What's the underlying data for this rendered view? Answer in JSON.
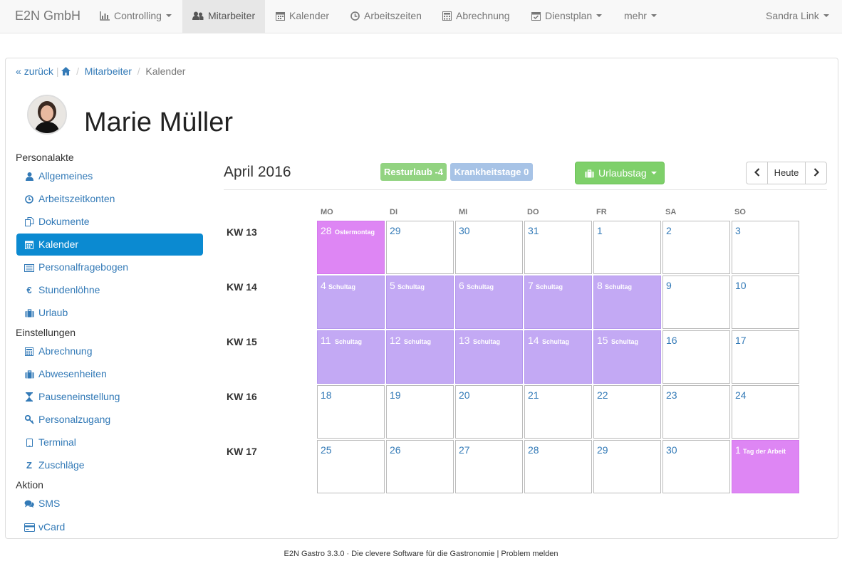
{
  "navbar": {
    "brand": "E2N GmbH",
    "items": [
      {
        "label": "Controlling",
        "icon": "bar-chart-icon"
      },
      {
        "label": "Mitarbeiter",
        "icon": "users-icon"
      },
      {
        "label": "Kalender",
        "icon": "calendar-icon"
      },
      {
        "label": "Arbeitszeiten",
        "icon": "clock-icon"
      },
      {
        "label": "Abrechnung",
        "icon": "calculator-icon"
      },
      {
        "label": "Dienstplan",
        "icon": "calendar-check-icon"
      },
      {
        "label": "mehr"
      }
    ],
    "user": "Sandra Link"
  },
  "breadcrumb": {
    "back": "zurück",
    "mitarbeiter": "Mitarbeiter",
    "current": "Kalender"
  },
  "employee": {
    "name": "Marie Müller"
  },
  "sidebar": {
    "sections": [
      {
        "title": "Personalakte",
        "items": [
          "Allgemeines",
          "Arbeitszeitkonten",
          "Dokumente",
          "Kalender",
          "Personalfragebogen",
          "Stundenlöhne",
          "Urlaub"
        ]
      },
      {
        "title": "Einstellungen",
        "items": [
          "Abrechnung",
          "Abwesenheiten",
          "Pauseneinstellung",
          "Personalzugang",
          "Terminal",
          "Zuschläge"
        ]
      },
      {
        "title": "Aktion",
        "items": [
          "SMS",
          "vCard"
        ]
      }
    ],
    "active": "Kalender"
  },
  "calendar": {
    "month_title": "April 2016",
    "label_resturlaub": "Resturlaub -4",
    "label_krankheitstage": "Krankheitstage 0",
    "urlaub_button": "Urlaubstag",
    "today_button": "Heute",
    "weekdays": [
      "MO",
      "DI",
      "MI",
      "DO",
      "FR",
      "SA",
      "SO"
    ],
    "weeks": [
      {
        "label": "KW 13",
        "days": [
          {
            "d": "28",
            "ev": "Ostermontag",
            "type": "holiday"
          },
          {
            "d": "29"
          },
          {
            "d": "30"
          },
          {
            "d": "31"
          },
          {
            "d": "1"
          },
          {
            "d": "2"
          },
          {
            "d": "3"
          }
        ]
      },
      {
        "label": "KW 14",
        "days": [
          {
            "d": "4",
            "ev": "Schultag",
            "type": "school"
          },
          {
            "d": "5",
            "ev": "Schultag",
            "type": "school"
          },
          {
            "d": "6",
            "ev": "Schultag",
            "type": "school"
          },
          {
            "d": "7",
            "ev": "Schultag",
            "type": "school"
          },
          {
            "d": "8",
            "ev": "Schultag",
            "type": "school"
          },
          {
            "d": "9"
          },
          {
            "d": "10"
          }
        ]
      },
      {
        "label": "KW 15",
        "days": [
          {
            "d": "11",
            "ev": "Schultag",
            "type": "school"
          },
          {
            "d": "12",
            "ev": "Schultag",
            "type": "school"
          },
          {
            "d": "13",
            "ev": "Schultag",
            "type": "school"
          },
          {
            "d": "14",
            "ev": "Schultag",
            "type": "school"
          },
          {
            "d": "15",
            "ev": "Schultag",
            "type": "school"
          },
          {
            "d": "16"
          },
          {
            "d": "17"
          }
        ]
      },
      {
        "label": "KW 16",
        "days": [
          {
            "d": "18"
          },
          {
            "d": "19"
          },
          {
            "d": "20"
          },
          {
            "d": "21"
          },
          {
            "d": "22"
          },
          {
            "d": "23"
          },
          {
            "d": "24"
          }
        ]
      },
      {
        "label": "KW 17",
        "days": [
          {
            "d": "25"
          },
          {
            "d": "26"
          },
          {
            "d": "27"
          },
          {
            "d": "28"
          },
          {
            "d": "29"
          },
          {
            "d": "30"
          },
          {
            "d": "1",
            "ev": "Tag der Arbeit",
            "type": "holiday"
          }
        ]
      }
    ]
  },
  "footer": {
    "text": "E2N Gastro 3.3.0 · Die clevere Software für die Gastronomie | ",
    "link": "Problem melden"
  }
}
